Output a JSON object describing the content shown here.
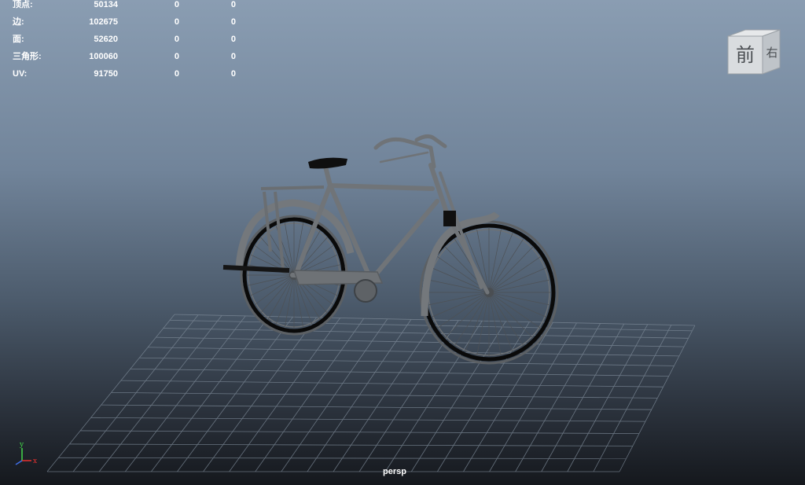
{
  "stats": {
    "rows": [
      {
        "label": "顶点:",
        "total": "50134",
        "selected": "0",
        "other": "0"
      },
      {
        "label": "边:",
        "total": "102675",
        "selected": "0",
        "other": "0"
      },
      {
        "label": "面:",
        "total": "52620",
        "selected": "0",
        "other": "0"
      },
      {
        "label": "三角形:",
        "total": "100060",
        "selected": "0",
        "other": "0"
      },
      {
        "label": "UV:",
        "total": "91750",
        "selected": "0",
        "other": "0"
      }
    ]
  },
  "viewcube": {
    "front": "前",
    "right": "右"
  },
  "axes": {
    "y": "y",
    "x": "x"
  },
  "camera": {
    "name": "persp"
  },
  "colors": {
    "axis_x": "#e8302f",
    "axis_y": "#43d84a",
    "axis_z": "#3f6ee8",
    "grid": "#8e9aa8",
    "model": "#6a6e72"
  }
}
